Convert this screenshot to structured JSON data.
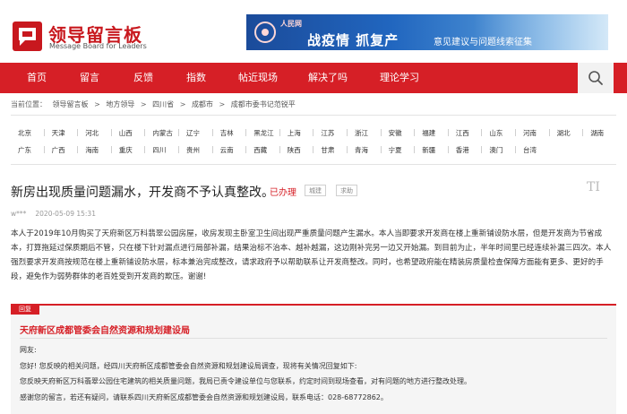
{
  "site": {
    "title": "领导留言板",
    "subtitle": "Message Board for Leaders"
  },
  "banner": {
    "brand": "人民网",
    "slogan": "战疫情 抓复产",
    "sub": "意见建议与问题线索征集"
  },
  "nav": {
    "items": [
      "首页",
      "留言",
      "反馈",
      "指数",
      "帖近现场",
      "解决了吗",
      "理论学习"
    ],
    "search_icon": "search-icon"
  },
  "breadcrumb": {
    "prefix": "当前位置：",
    "items": [
      "领导留言板",
      "地方领导",
      "四川省",
      "成都市",
      "成都市委书记范锐平"
    ],
    "separator": ">"
  },
  "regions": {
    "row1": [
      "北京",
      "天津",
      "河北",
      "山西",
      "内蒙古",
      "辽宁",
      "吉林",
      "黑龙江",
      "上海",
      "江苏",
      "浙江",
      "安徽",
      "福建",
      "江西",
      "山东",
      "河南",
      "湖北",
      "湖南"
    ],
    "row2": [
      "广东",
      "广西",
      "海南",
      "重庆",
      "四川",
      "贵州",
      "云南",
      "西藏",
      "陕西",
      "甘肃",
      "青海",
      "宁夏",
      "新疆",
      "香港",
      "澳门",
      "台湾"
    ]
  },
  "post": {
    "title": "新房出现质量问题漏水，开发商不予认真整改。",
    "status": "已办理",
    "tags": [
      "城建",
      "求助"
    ],
    "font_toggle": "TI",
    "author": "w***",
    "time": "2020-05-09 15:31",
    "body": "本人于2019年10月购买了天府新区万科翡翠公园房屋，收房发现主卧室卫生间出现严重质量问题产生漏水。本人当即要求开发商在楼上重新铺设防水层，但是开发商为节省成本，打算拖延过保质期后不管，只在楼下针对漏点进行局部补漏，结果治标不治本、越补越漏，这边刚补完另一边又开始漏。到目前为止，半年时间里已经连续补漏三四次。本人强烈要求开发商按规范在楼上重新铺设防水层，标本兼治完成整改，请求政府予以帮助联系让开发商整改。同时，也希望政府能在精装房质量检查保障方面能有更多、更好的手段，避免作为弱势群体的老百姓受到开发商的欺压。谢谢!"
  },
  "reply": {
    "tab": "回复",
    "org": "天府新区成都管委会自然资源和规划建设局",
    "lines": [
      "网友:",
      "您好! 您反映的相关问题，经四川天府新区成都管委会自然资源和规划建设局调查，现将有关情况回复如下:",
      "您反映天府新区万科翡翠公园住宅建筑的相关质量问题，我局已责令建设单位与您联系，约定时间到现场查看，对有问题的地方进行整改处理。",
      "感谢您的留言，若还有疑问，请联系四川天府新区成都管委会自然资源和规划建设局，联系电话：028-68772862。"
    ]
  },
  "colors": {
    "brand_red": "#d61f26",
    "banner_blue": "#1b4b9a"
  }
}
